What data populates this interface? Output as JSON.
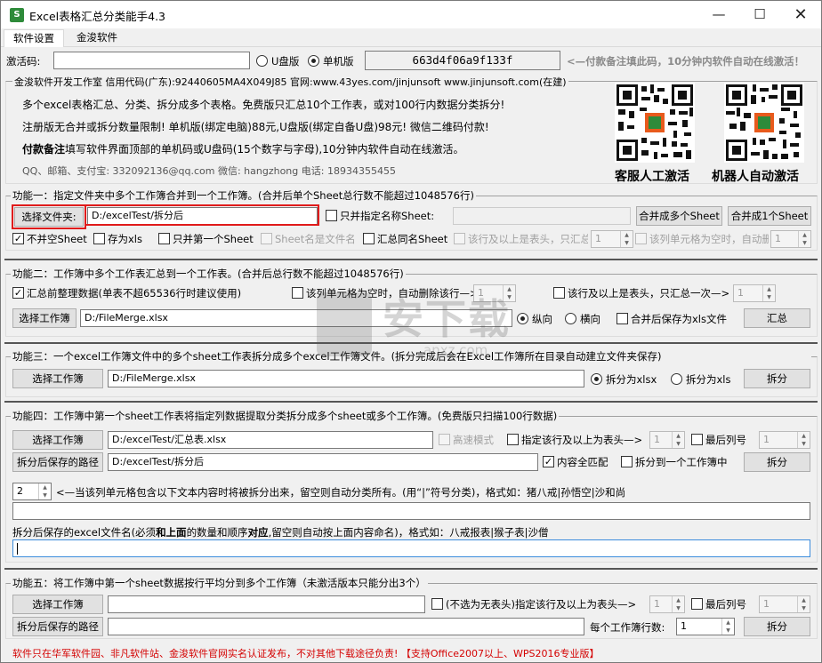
{
  "window": {
    "title": "Excel表格汇总分类能手4.3",
    "icon": "excel-app-icon"
  },
  "tabs": [
    "软件设置",
    "金浚软件"
  ],
  "activation": {
    "label": "激活码:",
    "code_value": "",
    "radio_u": "U盘版",
    "radio_single": "单机版",
    "machine_code": "663d4f06a9f133f",
    "hint": "<—付款备注填此码，10分钟内软件自动在线激活！"
  },
  "info": {
    "line1": "金浚软件开发工作室 信用代码(广东):92440605MA4X049J85 官网:www.43yes.com/jinjunsoft  www.jinjunsoft.com(在建)",
    "line2": "多个excel表格汇总、分类、拆分成多个表格。免费版只汇总10个工作表，或对100行内数据分类拆分!",
    "line3": "注册版无合并或拆分数量限制! 单机版(绑定电脑)88元,U盘版(绑定自备U盘)98元! 微信二维码付款!",
    "line4_bold": "付款备注",
    "line4_rest": "填写软件界面顶部的单机码或U盘码(15个数字与字母),10分钟内软件自动在线激活。",
    "line5": "QQ、邮箱、支付宝: 332092136@qq.com   微信: hangzhong   电话: 18934355455",
    "qr1_label": "客服人工激活",
    "qr2_label": "机器人自动激活"
  },
  "f1": {
    "title": "功能一：指定文件夹中多个工作簿合并到一个工作簿。(合并后单个Sheet总行数不能超过1048576行)",
    "choose_btn": "选择文件夹:",
    "path": "D:/excelTest/拆分后",
    "chk_only_sheet": "只并指定名称Sheet:",
    "merge_multi_btn": "合并成多个Sheet",
    "merge_one_btn": "合并成1个Sheet",
    "chk_no_empty": "不并空Sheet",
    "chk_save_xls": "存为xls",
    "chk_first_sheet": "只并第一个Sheet",
    "chk_name_is_file": "Sheet名是文件名",
    "chk_summary_same": "汇总同名Sheet",
    "chk_header_row": "该行及以上是表头，只汇总",
    "header_spin": "1",
    "chk_empty_col": "该列单元格为空时，自动删",
    "empty_spin": "1"
  },
  "f2": {
    "title": "功能二：工作簿中多个工作表汇总到一个工作表。(合并后总行数不能超过1048576行)",
    "chk_preprocess": "汇总前整理数据(单表不超65536行时建议使用)",
    "chk_empty_col": "该列单元格为空时，自动删除该行—>",
    "empty_spin": "1",
    "chk_header": "该行及以上是表头，只汇总一次—>",
    "header_spin": "1",
    "choose_btn": "选择工作簿",
    "path": "D:/FileMerge.xlsx",
    "radio_vertical": "纵向",
    "radio_horizontal": "横向",
    "chk_save_xls": "合并后保存为xls文件",
    "run_btn": "汇总"
  },
  "f3": {
    "title": "功能三：一个excel工作簿文件中的多个sheet工作表拆分成多个excel工作簿文件。(拆分完成后会在Excel工作簿所在目录自动建立文件夹保存)",
    "choose_btn": "选择工作簿",
    "path": "D:/FileMerge.xlsx",
    "radio_xlsx": "拆分为xlsx",
    "radio_xls": "拆分为xls",
    "run_btn": "拆分"
  },
  "f4": {
    "title": "功能四：工作簿中第一个sheet工作表将指定列数据提取分类拆分成多个sheet或多个工作簿。(免费版只扫描100行数据)",
    "choose_btn": "选择工作簿",
    "path": "D:/excelTest/汇总表.xlsx",
    "chk_fast": "高速模式",
    "chk_header": "指定该行及以上为表头—>",
    "header_spin": "1",
    "chk_last_col": "最后列号",
    "last_col_spin": "1",
    "save_path_btn": "拆分后保存的路径",
    "save_path": "D:/excelTest/拆分后",
    "chk_full_match": "内容全匹配",
    "chk_to_one": "拆分到一个工作簿中",
    "run_btn": "拆分",
    "col_spin": "2",
    "col_hint": "<—当该列单元格包含以下文本内容时将被拆分出来，留空则自动分类所有。(用“|”符号分类)，格式如：猪八戒|孙悟空|沙和尚",
    "name_hint_a": "拆分后保存的excel文件名(必须",
    "name_hint_b": "和上面",
    "name_hint_c": "的数量和顺序",
    "name_hint_d": "对应",
    "name_hint_e": ",留空则自动按上面内容命名)，格式如：八戒报表|猴子表|沙僧"
  },
  "f5": {
    "title": "功能五：将工作簿中第一个sheet数据按行平均分到多个工作簿（未激活版本只能分出3个）",
    "choose_btn": "选择工作簿",
    "chk_header": "(不选为无表头)指定该行及以上为表头—>",
    "header_spin": "1",
    "chk_last_col": "最后列号",
    "last_col_spin": "1",
    "save_path_btn": "拆分后保存的路径",
    "rows_label": "每个工作簿行数:",
    "rows_spin": "1",
    "run_btn": "拆分"
  },
  "footer": "软件只在华军软件园、非凡软件站、金浚软件官网实名认证发布，不对其他下载途径负责! 【支持Office2007以上、WPS2016专业版】",
  "watermark": "安下载",
  "watermark_sub": "anxz.com",
  "colors": {
    "footer_red": "#d40000",
    "highlight_red": "#e01b1b",
    "focus_blue": "#3c8cdc"
  }
}
